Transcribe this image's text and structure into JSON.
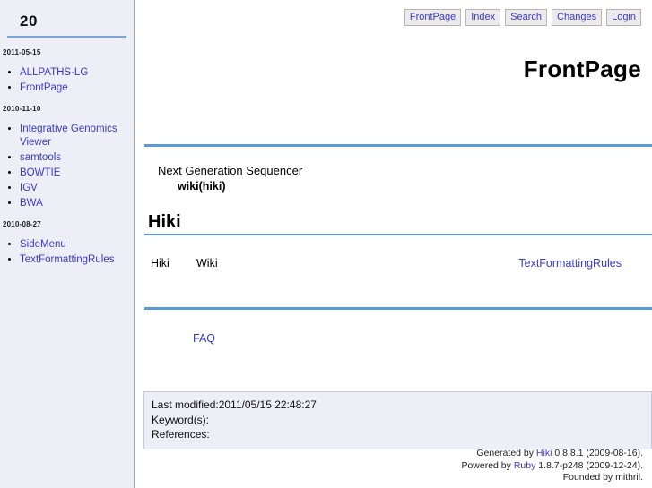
{
  "sidebar": {
    "title": "20",
    "groups": [
      {
        "date": "2011-05-15",
        "items": [
          {
            "label": "ALLPATHS-LG"
          },
          {
            "label": "FrontPage"
          }
        ]
      },
      {
        "date": "2010-11-10",
        "items": [
          {
            "label": "Integrative Genomics Viewer"
          },
          {
            "label": "samtools"
          },
          {
            "label": "BOWTIE"
          },
          {
            "label": "IGV"
          },
          {
            "label": "BWA"
          }
        ]
      },
      {
        "date": "2010-08-27",
        "items": [
          {
            "label": "SideMenu"
          },
          {
            "label": "TextFormattingRules"
          }
        ]
      }
    ]
  },
  "navbar": {
    "buttons": [
      {
        "label": "FrontPage"
      },
      {
        "label": "Index"
      },
      {
        "label": "Search"
      },
      {
        "label": "Changes"
      },
      {
        "label": "Login"
      }
    ]
  },
  "main": {
    "page_title": "FrontPage",
    "intro_line": "Next Generation Sequencer",
    "intro_sub": "wiki(hiki)",
    "section_heading": "Hiki",
    "word_hiki": "Hiki",
    "word_wiki": "Wiki",
    "link_text_formatting_rules": "TextFormattingRules",
    "link_faq": "FAQ"
  },
  "info": {
    "last_modified": "Last modified:2011/05/15 22:48:27",
    "keywords": "Keyword(s):",
    "references": "References:"
  },
  "credits": {
    "generated_prefix": "Generated by ",
    "generated_link": "Hiki",
    "generated_suffix": " 0.8.8.1 (2009-08-16).",
    "powered_prefix": "Powered by ",
    "powered_link": "Ruby",
    "powered_suffix": " 1.8.7-p248 (2009-12-24).",
    "founded": "Founded by mithril."
  },
  "colors": {
    "link": "#3a3ac8",
    "rule": "#5b9bd5",
    "sidebar_bg": "#eeeef7",
    "nav_btn_bg": "#eceaea"
  }
}
